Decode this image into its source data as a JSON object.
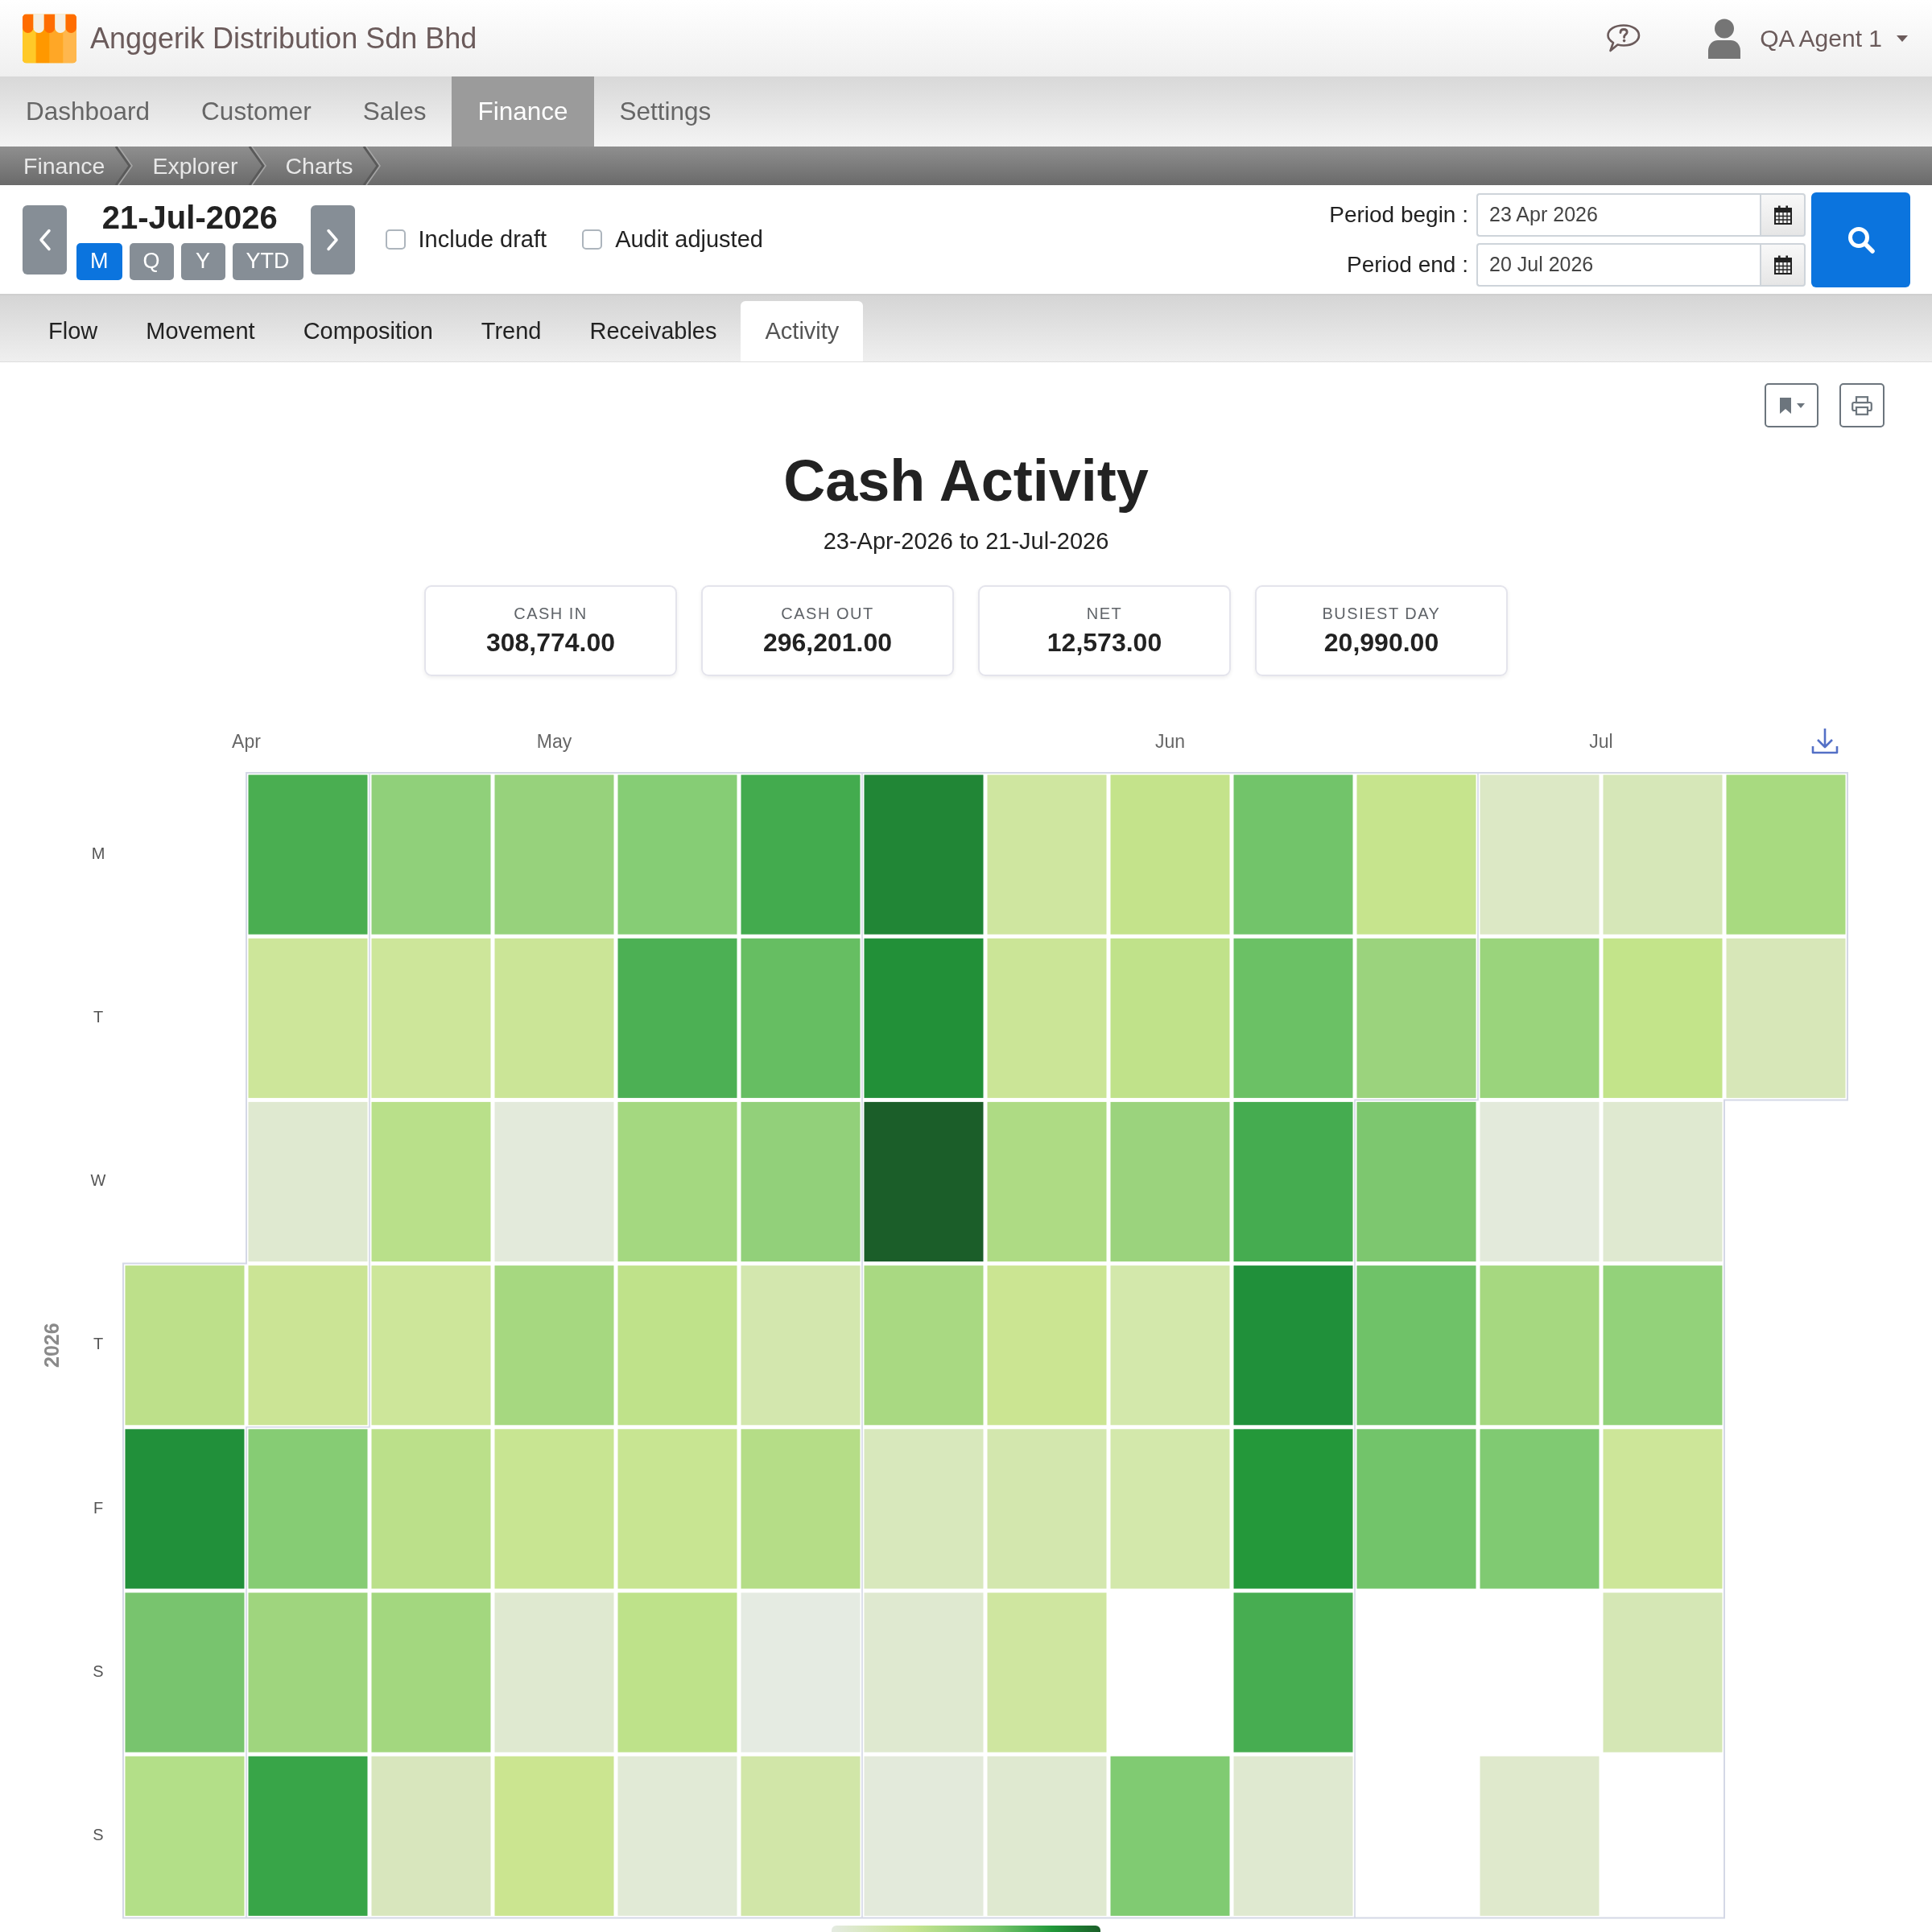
{
  "header": {
    "company": "Anggerik Distribution Sdn Bhd",
    "user": "QA Agent 1"
  },
  "nav": [
    {
      "label": "Dashboard",
      "selected": false
    },
    {
      "label": "Customer",
      "selected": false
    },
    {
      "label": "Sales",
      "selected": false
    },
    {
      "label": "Finance",
      "selected": true
    },
    {
      "label": "Settings",
      "selected": false
    }
  ],
  "breadcrumb": [
    "Finance",
    "Explorer",
    "Charts"
  ],
  "toolbar": {
    "date": "21-Jul-2026",
    "periods": [
      {
        "label": "M",
        "selected": true
      },
      {
        "label": "Q",
        "selected": false
      },
      {
        "label": "Y",
        "selected": false
      },
      {
        "label": "YTD",
        "selected": false
      }
    ],
    "options": [
      {
        "label": "Include draft",
        "checked": false
      },
      {
        "label": "Audit adjusted",
        "checked": false
      }
    ],
    "fields": [
      {
        "label": "Period begin :",
        "value": "23 Apr 2026"
      },
      {
        "label": "Period end :",
        "value": "20 Jul 2026"
      }
    ]
  },
  "tabs": [
    {
      "label": "Flow",
      "selected": false
    },
    {
      "label": "Movement",
      "selected": false
    },
    {
      "label": "Composition",
      "selected": false
    },
    {
      "label": "Trend",
      "selected": false
    },
    {
      "label": "Receivables",
      "selected": false
    },
    {
      "label": "Activity",
      "selected": true
    }
  ],
  "report": {
    "title": "Cash Activity",
    "subtitle": "23-Apr-2026 to 21-Jul-2026",
    "cards": [
      {
        "label": "CASH IN",
        "value": "308,774.00"
      },
      {
        "label": "CASH OUT",
        "value": "296,201.00"
      },
      {
        "label": "NET",
        "value": "12,573.00"
      },
      {
        "label": "BUSIEST DAY",
        "value": "20,990.00"
      }
    ]
  },
  "calendar": {
    "months": [
      "Apr",
      "May",
      "Jun",
      "Jul"
    ],
    "weekdays": [
      "M",
      "T",
      "W",
      "T",
      "F",
      "S",
      "S"
    ],
    "year": "2026"
  }
}
